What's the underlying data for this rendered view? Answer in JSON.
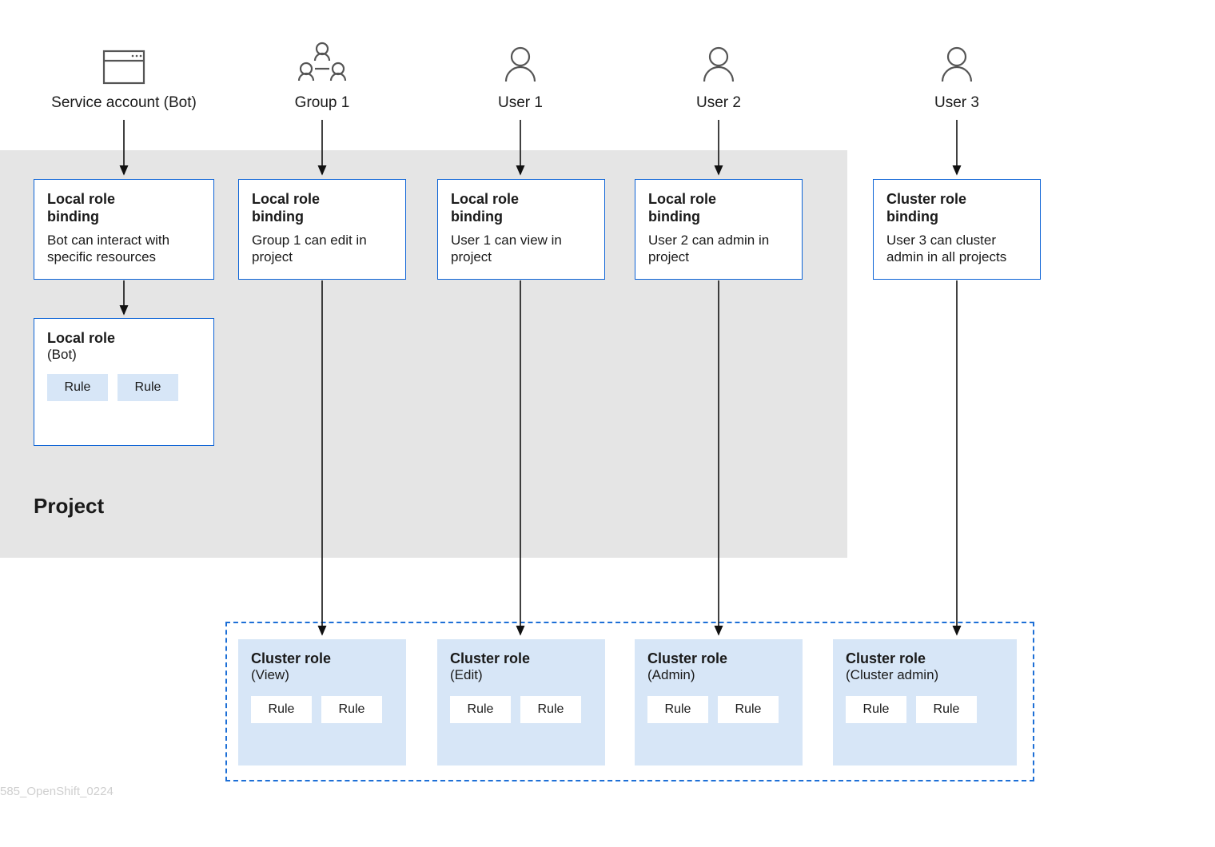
{
  "entities": {
    "service_account": "Service account (Bot)",
    "group1": "Group 1",
    "user1": "User 1",
    "user2": "User 2",
    "user3": "User 3"
  },
  "project_label": "Project",
  "bindings": {
    "bot": {
      "title": "Local role\nbinding",
      "body": "Bot can interact with specific resources"
    },
    "group1": {
      "title": "Local role\nbinding",
      "body": "Group 1 can edit in project"
    },
    "user1": {
      "title": "Local role\nbinding",
      "body": "User 1 can view in project"
    },
    "user2": {
      "title": "Local role\nbinding",
      "body": "User 2 can admin in project"
    },
    "user3": {
      "title": "Cluster role\nbinding",
      "body": "User 3 can cluster admin in all projects"
    }
  },
  "local_role": {
    "title": "Local role",
    "subtitle": "(Bot)",
    "rules": [
      "Rule",
      "Rule"
    ]
  },
  "cluster_roles": {
    "view": {
      "title": "Cluster role",
      "subtitle": "(View)",
      "rules": [
        "Rule",
        "Rule"
      ]
    },
    "edit": {
      "title": "Cluster role",
      "subtitle": "(Edit)",
      "rules": [
        "Rule",
        "Rule"
      ]
    },
    "admin": {
      "title": "Cluster role",
      "subtitle": "(Admin)",
      "rules": [
        "Rule",
        "Rule"
      ]
    },
    "cadmin": {
      "title": "Cluster role",
      "subtitle": "(Cluster admin)",
      "rules": [
        "Rule",
        "Rule"
      ]
    }
  },
  "watermark": "585_OpenShift_0224",
  "colors": {
    "border_blue": "#0c63d6",
    "fill_blue": "#d7e6f7",
    "project_bg": "#e5e5e5"
  }
}
